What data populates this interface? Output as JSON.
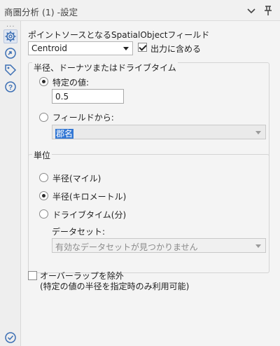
{
  "window": {
    "title": "商圏分析 (1) -設定"
  },
  "sidebar": {
    "dots": "...",
    "icons": [
      "gear-icon",
      "connection-icon",
      "tag-icon",
      "help-icon"
    ],
    "bottom_icon": "check-circle-icon"
  },
  "point_source": {
    "label": "ポイントソースとなるSpatialObjectフィールド",
    "selected": "Centroid",
    "include_output_label": "出力に含める",
    "include_output_checked": true
  },
  "radius_group": {
    "title": "半径、ドーナツまたはドライブタイム",
    "specific_value_label": "特定の値:",
    "specific_value_selected": true,
    "specific_value": "0.5",
    "from_field_label": "フィールドから:",
    "from_field_selected": false,
    "from_field_value": "郡名"
  },
  "unit_group": {
    "title": "単位",
    "options": [
      {
        "label": "半径(マイル)",
        "selected": false
      },
      {
        "label": "半径(キロメートル)",
        "selected": true
      },
      {
        "label": "ドライブタイム(分)",
        "selected": false
      }
    ],
    "dataset_label": "データセット:",
    "dataset_value": "有効なデータセットが見つかりません"
  },
  "overlap": {
    "label": "オーバーラップを除外",
    "note": "(特定の値の半径を指定時のみ利用可能)",
    "checked": false
  },
  "colors": {
    "accent": "#3478d4",
    "background": "#f4f4f4"
  }
}
